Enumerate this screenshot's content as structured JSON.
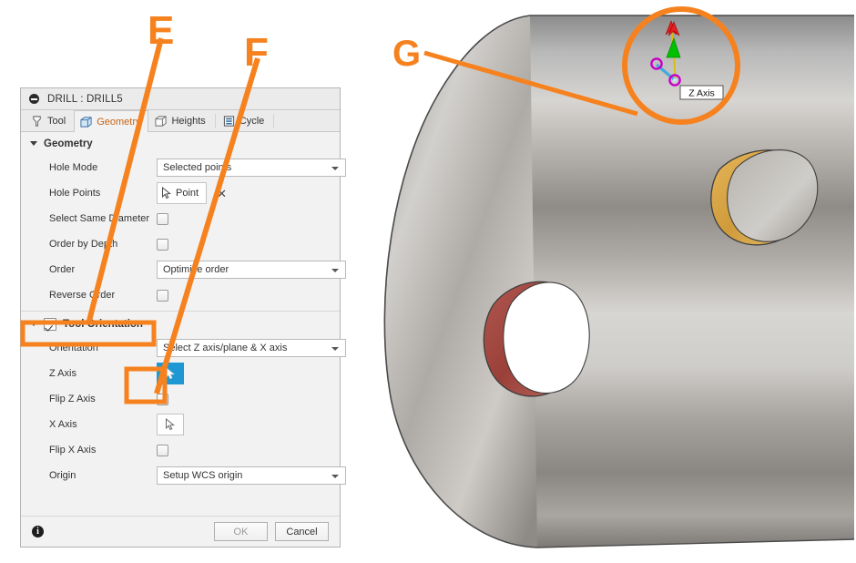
{
  "dialog": {
    "title": "DRILL : DRILL5",
    "collapse_icon": "collapse-circle-icon",
    "tabs": [
      {
        "label": "Tool",
        "icon": "tool-bit-icon",
        "active": false
      },
      {
        "label": "Geometry",
        "icon": "geometry-cube-icon",
        "active": true
      },
      {
        "label": "Heights",
        "icon": "heights-cube-icon",
        "active": false
      },
      {
        "label": "Cycle",
        "icon": "cycle-lines-icon",
        "active": false
      }
    ],
    "sections": [
      {
        "name": "geometry",
        "header": "Geometry",
        "has_checkbox": false,
        "rows": [
          {
            "type": "select",
            "label": "Hole Mode",
            "value": "Selected points"
          },
          {
            "type": "pick",
            "label": "Hole Points",
            "value": "Point",
            "clear": "✕"
          },
          {
            "type": "checkbox",
            "label": "Select Same Diameter",
            "checked": false
          },
          {
            "type": "checkbox",
            "label": "Order by Depth",
            "checked": false
          },
          {
            "type": "select",
            "label": "Order",
            "value": "Optimize order"
          },
          {
            "type": "checkbox",
            "label": "Reverse Order",
            "checked": false
          }
        ]
      },
      {
        "name": "tool-orientation",
        "header": "Tool Orientation",
        "has_checkbox": true,
        "checked": true,
        "rows": [
          {
            "type": "select",
            "label": "Orientation",
            "value": "Select Z axis/plane & X axis"
          },
          {
            "type": "pickempty",
            "label": "Z Axis",
            "selected": true
          },
          {
            "type": "checkbox",
            "label": "Flip Z Axis",
            "checked": false
          },
          {
            "type": "pickempty",
            "label": "X Axis",
            "selected": false
          },
          {
            "type": "checkbox",
            "label": "Flip X Axis",
            "checked": false
          },
          {
            "type": "select",
            "label": "Origin",
            "value": "Setup WCS origin"
          }
        ]
      }
    ],
    "footer": {
      "info_icon": "info-icon",
      "ok_label": "OK",
      "ok_disabled": true,
      "cancel_label": "Cancel"
    }
  },
  "viewport": {
    "model": "cylindrical-part-with-two-holes",
    "gizmo_tooltip": "Z Axis",
    "hole_colors": {
      "upper": "#d9a441",
      "lower": "#a84a41"
    },
    "gizmo_colors": {
      "z_arrow": "#00c000",
      "flip_arrow": "#e02020",
      "axis_line": "#d8c000",
      "handle_ring": "#c800c8",
      "handle_line": "#3fa9e0"
    }
  },
  "annotations": {
    "accent_color": "#f5821f",
    "letters": [
      {
        "id": "E",
        "text": "E",
        "target": "tool-orientation-section-header"
      },
      {
        "id": "F",
        "text": "F",
        "target": "z-axis-pick-button"
      },
      {
        "id": "G",
        "text": "G",
        "target": "z-axis-gizmo-in-viewport"
      }
    ],
    "highlight_boxes": [
      {
        "id": "tool-orientation-box",
        "target": "tool-orientation-section-header"
      },
      {
        "id": "z-axis-button-box",
        "target": "z-axis-pick-button"
      }
    ],
    "highlight_circles": [
      {
        "id": "gizmo-circle",
        "target": "z-axis-gizmo-in-viewport"
      }
    ]
  }
}
